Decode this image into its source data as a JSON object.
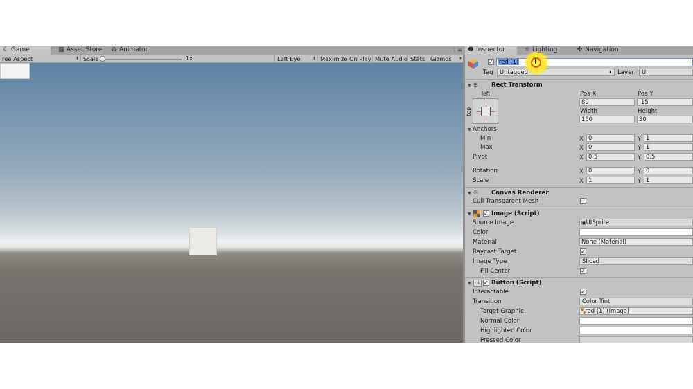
{
  "tabs": {
    "game": "Game",
    "asset_store": "Asset Store",
    "animator": "Animator",
    "inspector": "Inspector",
    "lighting": "Lighting",
    "navigation": "Navigation"
  },
  "game_toolbar": {
    "aspect": "ree Aspect",
    "scale_label": "Scale",
    "scale_value": "1x",
    "scale_fraction": 0.0,
    "eye": "Left Eye",
    "maximize": "Maximize On Play",
    "mute": "Mute Audio",
    "stats": "Stats",
    "gizmos": "Gizmos"
  },
  "header": {
    "active": true,
    "object_name": "red (1)",
    "tag_label": "Tag",
    "tag_value": "Untagged",
    "layer_label": "Layer",
    "layer_value": "UI"
  },
  "rect_transform": {
    "title": "Rect Transform",
    "anchor_h": "left",
    "anchor_v": "top",
    "pos_x_label": "Pos X",
    "pos_y_label": "Pos Y",
    "pos_x": "80",
    "pos_y": "-15",
    "width_label": "Width",
    "height_label": "Height",
    "width": "160",
    "height": "30",
    "anchors_label": "Anchors",
    "min_label": "Min",
    "min_x": "0",
    "min_y": "1",
    "max_label": "Max",
    "max_x": "0",
    "max_y": "1",
    "pivot_label": "Pivot",
    "pivot_x": "0.5",
    "pivot_y": "0.5",
    "rotation_label": "Rotation",
    "rot_x": "0",
    "rot_y": "0",
    "scale_label": "Scale",
    "scale_x": "1",
    "scale_y": "1",
    "x_axis": "X",
    "y_axis": "Y"
  },
  "canvas_renderer": {
    "title": "Canvas Renderer",
    "cull_label": "Cull Transparent Mesh",
    "cull_value": false
  },
  "image_script": {
    "title": "Image (Script)",
    "enabled": true,
    "source_image_label": "Source Image",
    "source_image": "UISprite",
    "color_label": "Color",
    "material_label": "Material",
    "material": "None (Material)",
    "raycast_label": "Raycast Target",
    "raycast_value": true,
    "image_type_label": "Image Type",
    "image_type": "Sliced",
    "fill_center_label": "Fill Center",
    "fill_center_value": true
  },
  "button_script": {
    "title": "Button (Script)",
    "enabled": true,
    "interactable_label": "Interactable",
    "interactable_value": true,
    "transition_label": "Transition",
    "transition": "Color Tint",
    "target_graphic_label": "Target Graphic",
    "target_graphic": "red (1) (Image)",
    "normal_color_label": "Normal Color",
    "highlighted_color_label": "Highlighted Color",
    "pressed_color_label": "Pressed Color"
  },
  "colors": {
    "panel": "#c2c2c2",
    "tab_active": "#c6c6c6",
    "highlight": "#ffe52a",
    "cursor_ring": "#d65a12"
  }
}
